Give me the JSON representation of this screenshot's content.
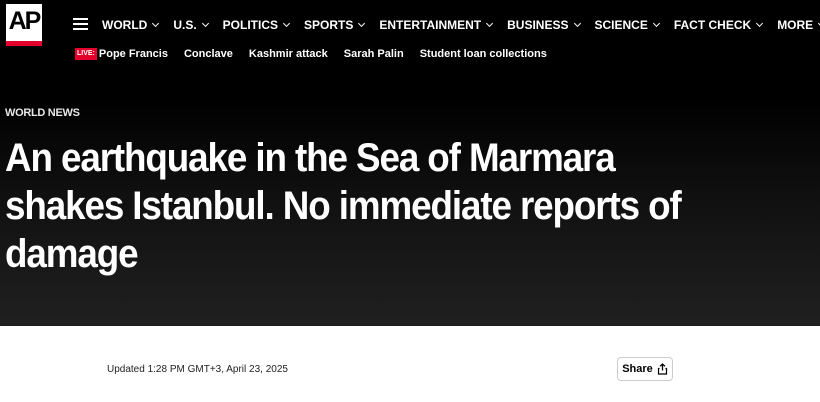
{
  "brand": {
    "logo_text": "AP"
  },
  "nav": {
    "items": [
      {
        "label": "WORLD"
      },
      {
        "label": "U.S."
      },
      {
        "label": "POLITICS"
      },
      {
        "label": "SPORTS"
      },
      {
        "label": "ENTERTAINMENT"
      },
      {
        "label": "BUSINESS"
      },
      {
        "label": "SCIENCE"
      },
      {
        "label": "FACT CHECK"
      },
      {
        "label": "MORE"
      }
    ]
  },
  "trending": {
    "live_badge": "LIVE:",
    "items": [
      {
        "label": "Pope Francis"
      },
      {
        "label": "Conclave"
      },
      {
        "label": "Kashmir attack"
      },
      {
        "label": "Sarah Palin"
      },
      {
        "label": "Student loan collections"
      }
    ]
  },
  "article": {
    "section": "WORLD NEWS",
    "headline": "An earthquake in the Sea of Marmara shakes Istanbul. No immediate reports of damage",
    "updated": "Updated 1:28 PM GMT+3, April 23, 2025",
    "share_label": "Share"
  },
  "colors": {
    "accent": "#e4002b",
    "background_top": "#000000",
    "text": "#ffffff"
  },
  "icons": [
    "menu-icon",
    "chevron-down-icon",
    "share-icon"
  ]
}
